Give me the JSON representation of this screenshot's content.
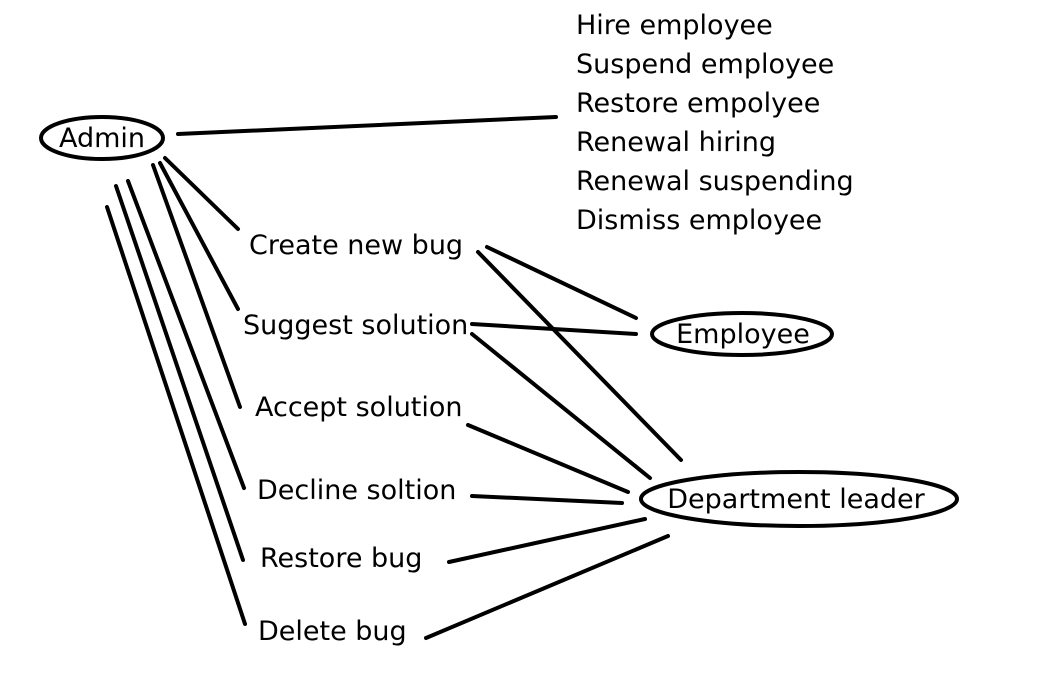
{
  "actors": {
    "admin": "Admin",
    "employee": "Employee",
    "department_leader": "Department leader"
  },
  "admin_actions": [
    "Hire employee",
    "Suspend employee",
    "Restore empolyee",
    "Renewal hiring",
    "Renewal suspending",
    "Dismiss employee"
  ],
  "use_cases": {
    "create_new_bug": "Create new bug",
    "suggest_solution": "Suggest solution",
    "accept_solution": "Accept solution",
    "decline_solution": "Decline soltion",
    "restore_bug": "Restore bug",
    "delete_bug": "Delete bug"
  }
}
